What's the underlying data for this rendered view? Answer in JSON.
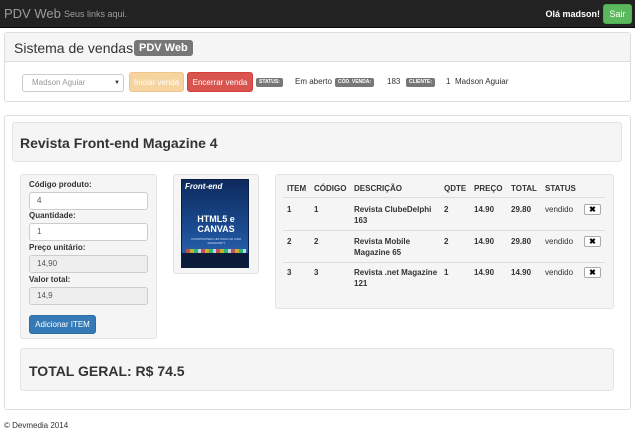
{
  "navbar": {
    "brand": "PDV Web",
    "link": "Seus links aqui.",
    "greeting": "Olá madson!",
    "logout_label": "Sair"
  },
  "header": {
    "title": "Sistema de vendas",
    "badge": "PDV Web"
  },
  "sale_bar": {
    "client_select": "Madson Aguiar",
    "start_label": "Iniciar venda",
    "end_label": "Encerrar venda",
    "status_label": "STATUS:",
    "status_value": "Em aberto",
    "code_label": "CÓD. VENDA:",
    "code_value": "183",
    "client_label": "CLIENTE:",
    "client_id": "1",
    "client_name": "Madson Aguiar"
  },
  "product": {
    "title": "Revista Front-end Magazine 4",
    "cover": {
      "brand": "Front-end",
      "headline_1": "HTML5 e",
      "headline_2": "CANVAS",
      "subtitle": "CONSTRUINDO UM JOGO 2D COM JAVASCRIPT"
    }
  },
  "form": {
    "code_label": "Código produto:",
    "code_value": "4",
    "qty_label": "Quantidade:",
    "qty_value": "1",
    "unit_price_label": "Preço unitário:",
    "unit_price_value": "14,90",
    "total_label": "Valor total:",
    "total_value": "14,9",
    "add_label": "Adicionar ITEM"
  },
  "table": {
    "headers": [
      "ITEM",
      "CÓDIGO",
      "DESCRIÇÃO",
      "QDTE",
      "PREÇO",
      "TOTAL",
      "STATUS"
    ],
    "rows": [
      {
        "item": "1",
        "code": "1",
        "desc_1": "Revista ClubeDelphi",
        "desc_2": "163",
        "qty": "2",
        "price": "14.90",
        "total": "29.80",
        "status": "vendido"
      },
      {
        "item": "2",
        "code": "2",
        "desc_1": "Revista Mobile",
        "desc_2": "Magazine 65",
        "qty": "2",
        "price": "14.90",
        "total": "29.80",
        "status": "vendido"
      },
      {
        "item": "3",
        "code": "3",
        "desc_1": "Revista .net Magazine",
        "desc_2": "121",
        "qty": "1",
        "price": "14.90",
        "total": "14.90",
        "status": "vendido"
      }
    ],
    "remove_glyph": "✖"
  },
  "grand_total": "TOTAL GERAL: R$ 74.5",
  "footer": "© Devmedia 2014"
}
